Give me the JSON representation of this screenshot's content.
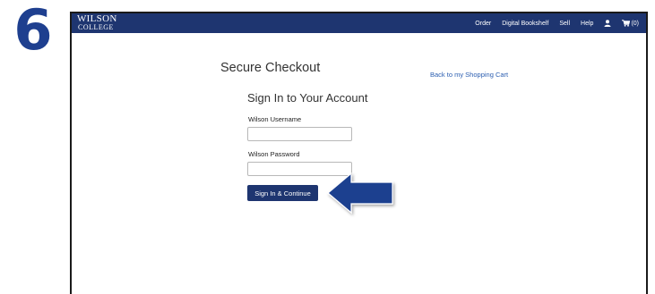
{
  "step": {
    "number": "6",
    "color": "#1e3f8f"
  },
  "navbar": {
    "brand_line1": "WILSON",
    "brand_line2": "COLLEGE",
    "background": "#1e3570",
    "items": [
      {
        "label": "Order"
      },
      {
        "label": "Digital Bookshelf"
      },
      {
        "label": "Sell"
      },
      {
        "label": "Help"
      }
    ],
    "user_icon": "user-icon",
    "cart_icon": "cart-icon",
    "cart_count": "(0)"
  },
  "checkout": {
    "title": "Secure Checkout",
    "back_link": "Back to my Shopping Cart",
    "link_color": "#2a5db0"
  },
  "signin": {
    "heading": "Sign In to Your Account",
    "username_label": "Wilson Username",
    "username_value": "",
    "password_label": "Wilson Password",
    "password_value": "",
    "button_label": "Sign In & Continue",
    "button_color": "#1e3570"
  },
  "annotation": {
    "icon": "arrow-left-icon",
    "color": "#1e3f8f"
  }
}
